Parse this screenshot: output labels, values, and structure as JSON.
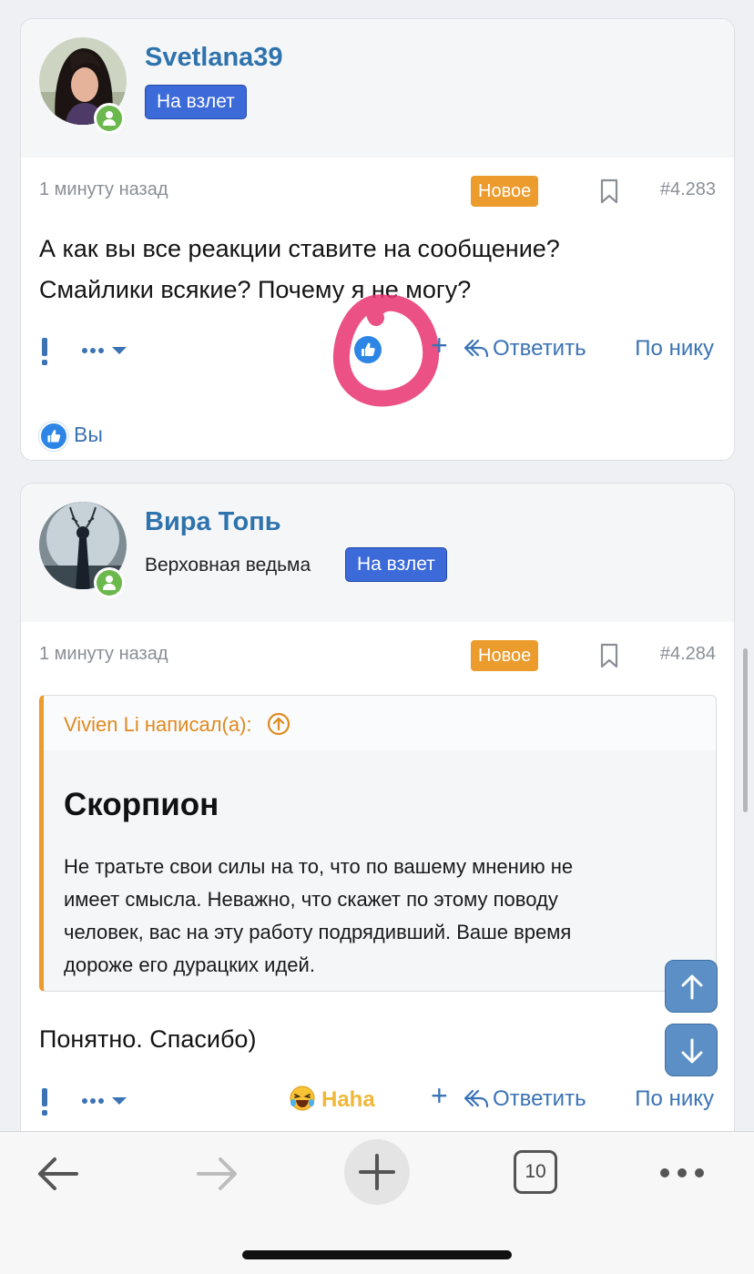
{
  "posts": [
    {
      "username": "Svetlana39",
      "rank_badge": "На взлет",
      "time": "1 минуту назад",
      "new_badge": "Новое",
      "post_number": "#4.283",
      "text_lines": [
        "А как вы все реакции ставите на сообщение?",
        "Смайлики всякие? Почему я не могу?"
      ],
      "actions": {
        "reply": "Ответить",
        "by_nick": "По нику"
      },
      "reactions_summary": "Вы"
    },
    {
      "username": "Вира Топь",
      "user_title": "Верховная ведьма",
      "rank_badge": "На взлет",
      "time": "1 минуту назад",
      "new_badge": "Новое",
      "post_number": "#4.284",
      "quote": {
        "author": "Vivien Li написал(а):",
        "title": "Скорпион",
        "lines": [
          "Не тратьте свои силы на то, что по вашему мнению не",
          "имеет смысла. Неважно, что скажет по этому поводу",
          "человек, вас на эту работу подрядивший. Ваше время",
          "дороже его дурацких идей."
        ]
      },
      "text": "Понятно. Спасибо)",
      "actions": {
        "reaction": "Haha",
        "reply": "Ответить",
        "by_nick": "По нику"
      }
    }
  ],
  "browser": {
    "tab_count": "10"
  },
  "colors": {
    "accent": "#3b73b5",
    "new_badge": "#ec9b2d",
    "rank_badge": "#3c6ad8",
    "online": "#6bb84d",
    "highlight": "#e8336f"
  },
  "icons": [
    "report-icon",
    "more-options-icon",
    "like-icon",
    "add-reaction-icon",
    "reply-icon",
    "bookmark-icon",
    "quote-jump-icon",
    "haha-emoji-icon",
    "scroll-up-icon",
    "scroll-down-icon",
    "back-icon",
    "forward-icon",
    "new-tab-icon",
    "tabs-icon",
    "menu-icon"
  ]
}
